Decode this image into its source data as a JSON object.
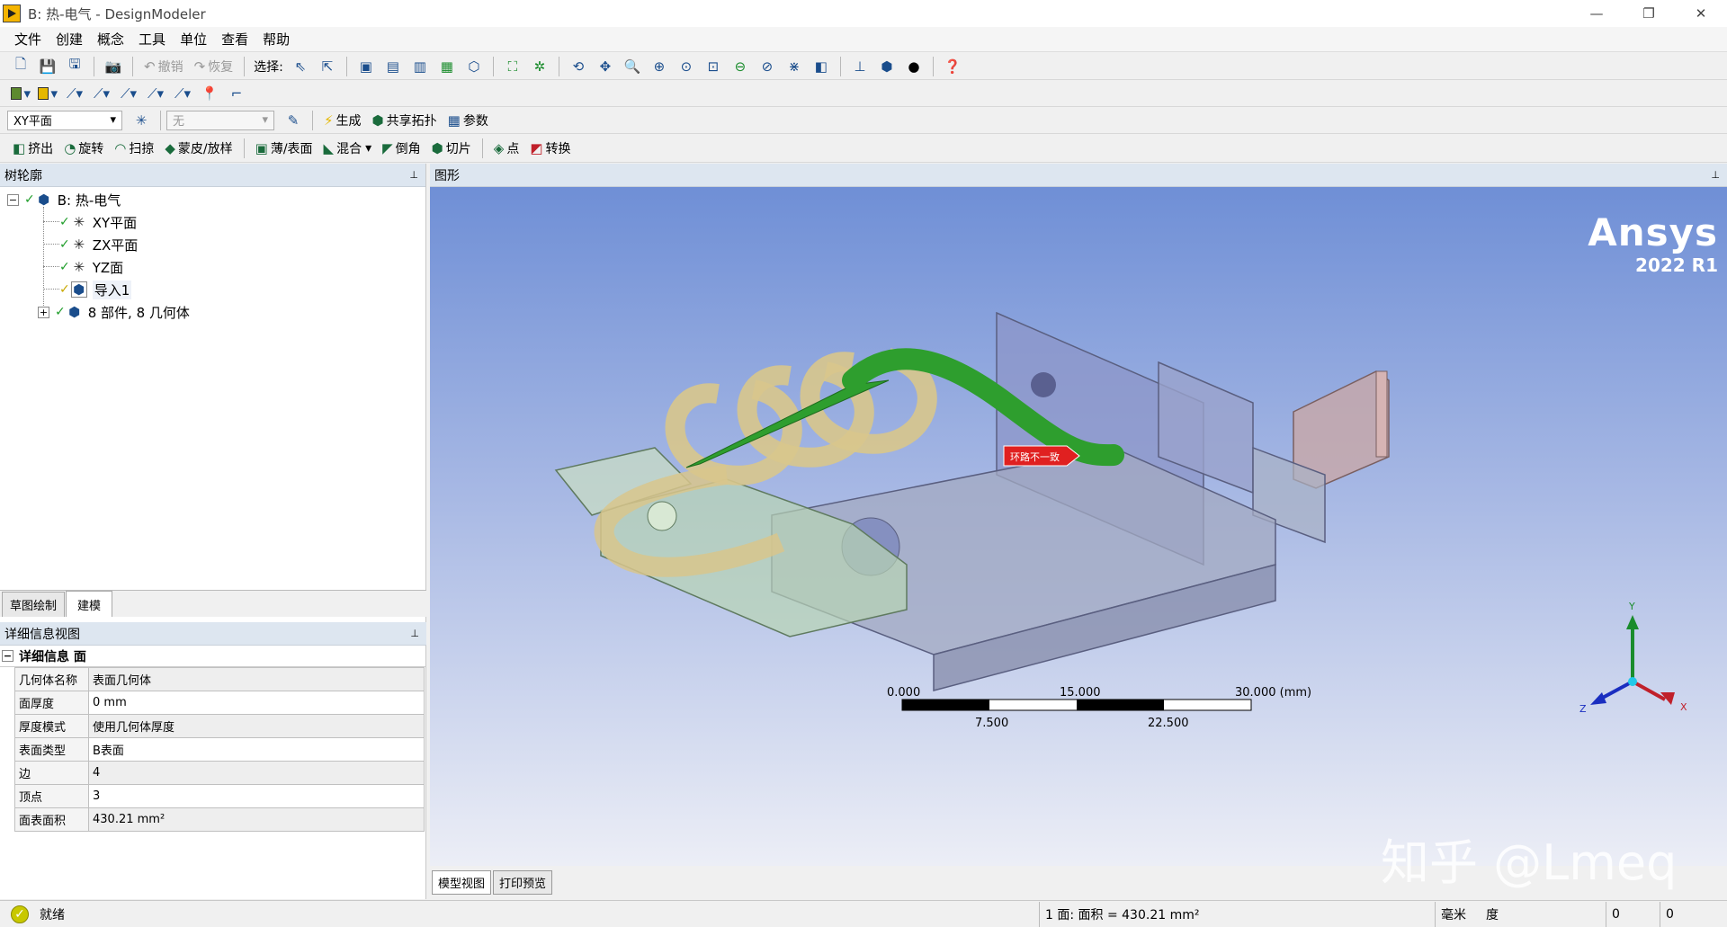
{
  "window": {
    "title": "B: 热-电气 - DesignModeler",
    "minimize": "—",
    "restore": "❐",
    "close": "✕"
  },
  "menu": [
    "文件",
    "创建",
    "概念",
    "工具",
    "单位",
    "查看",
    "帮助"
  ],
  "toolbar1": {
    "undo": "撤销",
    "redo": "恢复",
    "select_label": "选择:"
  },
  "toolbar3": {
    "plane": "XY平面",
    "sketch": "无",
    "generate": "生成",
    "share_topology": "共享拓扑",
    "parameters": "参数"
  },
  "toolbar4": {
    "extrude": "挤出",
    "revolve": "旋转",
    "sweep": "扫掠",
    "skin_loft": "蒙皮/放样",
    "thin_surface": "薄/表面",
    "blend": "混合",
    "chamfer": "倒角",
    "slice": "切片",
    "point": "点",
    "convert": "转换"
  },
  "tree_panel": {
    "title": "树轮廓",
    "pin": "📌",
    "root": "B: 热-电气",
    "items": [
      "XY平面",
      "ZX平面",
      "YZ面",
      "导入1",
      "8 部件, 8 几何体"
    ]
  },
  "mode_tabs": [
    "草图绘制",
    "建模"
  ],
  "details_panel": {
    "title": "详细信息视图",
    "group": "详细信息 面",
    "rows": [
      {
        "key": "几何体名称",
        "value": "表面几何体"
      },
      {
        "key": "面厚度",
        "value": "0 mm"
      },
      {
        "key": "厚度模式",
        "value": "使用几何体厚度"
      },
      {
        "key": "表面类型",
        "value": "B表面"
      },
      {
        "key": "边",
        "value": "4"
      },
      {
        "key": "顶点",
        "value": "3"
      },
      {
        "key": "面表面积",
        "value": "430.21 mm²"
      }
    ]
  },
  "graphics": {
    "title": "图形",
    "brand_name": "Ansys",
    "brand_version": "2022 R1",
    "warning_label": "环路不一致",
    "scale": {
      "top": [
        "0.000",
        "15.000",
        "30.000 (mm)"
      ],
      "bottom": [
        "7.500",
        "22.500"
      ]
    },
    "triad": {
      "x": "X",
      "y": "Y",
      "z": "Z"
    },
    "tabs": [
      "模型视图",
      "打印预览"
    ]
  },
  "watermark": "知乎 @Lmeq",
  "status": {
    "ready": "就绪",
    "selection": "1 面: 面积 = 430.21 mm²",
    "length_unit": "毫米",
    "angle_unit": "度",
    "val1": "0",
    "val2": "0"
  },
  "colors": {
    "viewport_top": "#6f8fd6",
    "viewport_bottom": "#eceef6",
    "warning_red": "#e02020",
    "selected_green": "#2e9e2e"
  }
}
